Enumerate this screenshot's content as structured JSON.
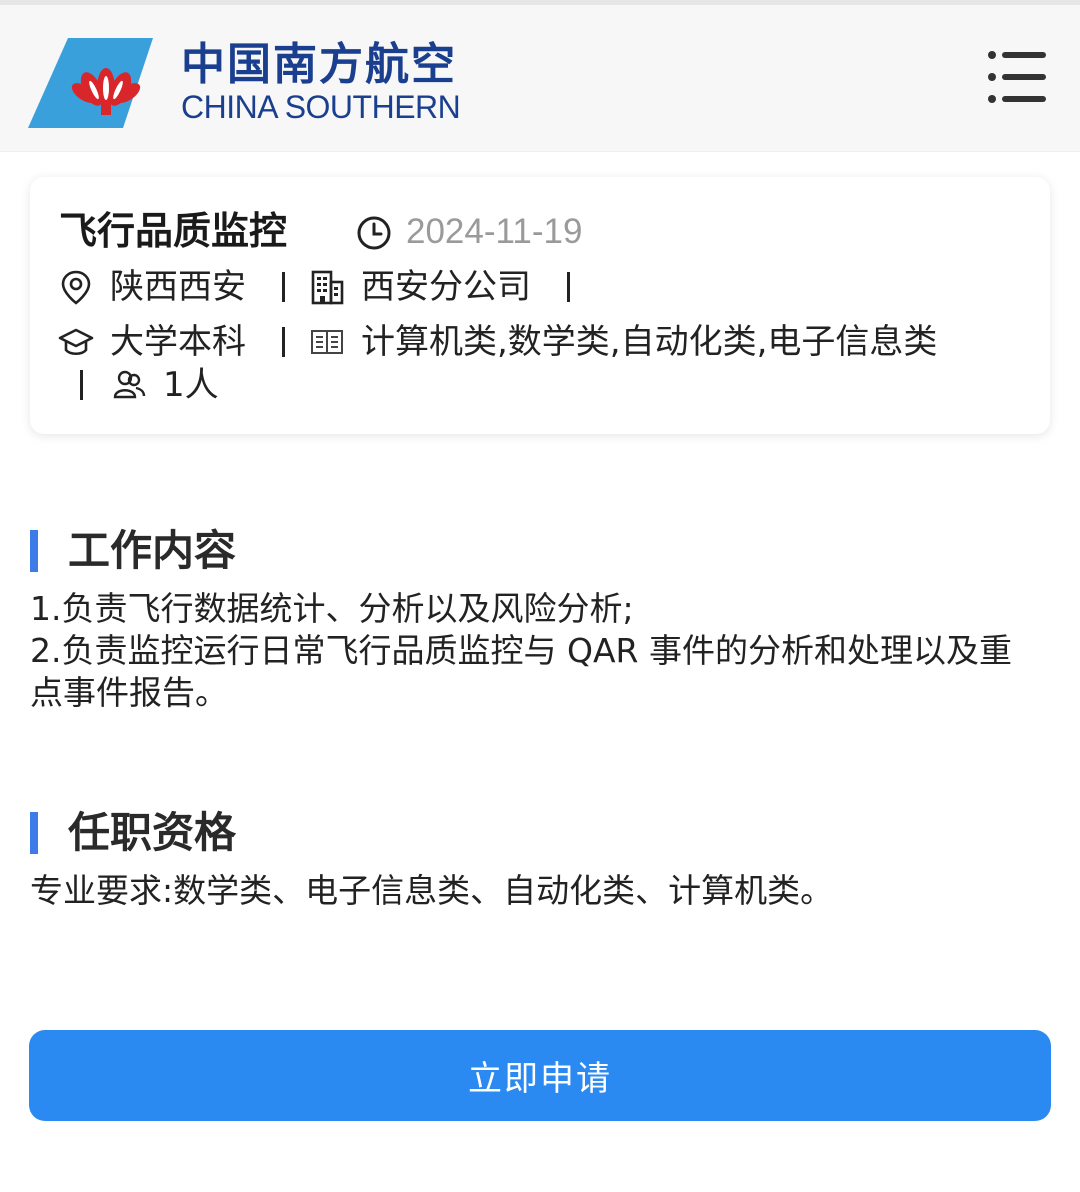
{
  "header": {
    "brand_cn": "中国南方航空",
    "brand_en": "CHINA SOUTHERN",
    "menu_icon": "hamburger-menu-icon",
    "brand_colors": {
      "primary": "#1b3f8f",
      "tail": "#3aa0dc",
      "flower": "#d8262b"
    }
  },
  "job": {
    "title": "飞行品质监控",
    "date": "2024-11-19",
    "location": "陕西西安",
    "company": "西安分公司",
    "education": "大学本科",
    "majors": "计算机类,数学类,自动化类,电子信息类",
    "headcount": "1人",
    "icons": [
      "clock-icon",
      "location-pin-icon",
      "building-icon",
      "graduation-cap-icon",
      "book-icon",
      "people-icon"
    ]
  },
  "sections": {
    "duties": {
      "title": "工作内容",
      "line1": "1.负责飞行数据统计、分析以及风险分析;",
      "line2": "2.负责监控运行日常飞行品质监控与 QAR 事件的分析和处理以及重点事件报告。"
    },
    "requirements": {
      "title": "任职资格",
      "line1": "专业要求:数学类、电子信息类、自动化类、计算机类。"
    }
  },
  "apply": {
    "label": "立即申请",
    "color": "#2a8af2"
  },
  "accent_color": "#3d7be8"
}
